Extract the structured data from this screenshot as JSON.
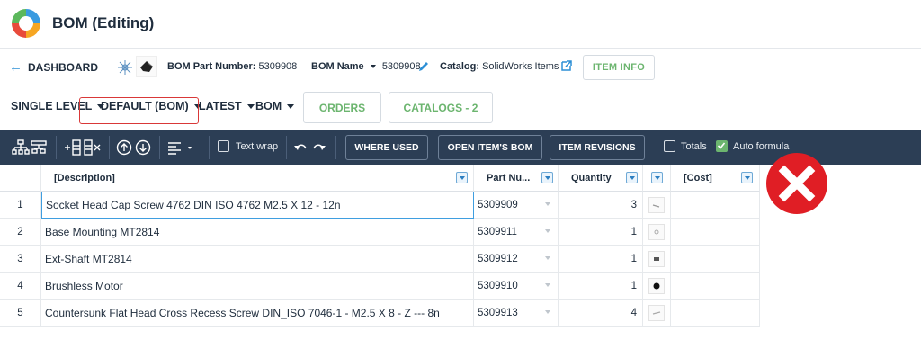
{
  "app": {
    "title": "BOM (Editing)"
  },
  "nav": {
    "back_label": "DASHBOARD",
    "part_number_label": "BOM Part Number:",
    "part_number_value": "5309908",
    "bom_name_label": "BOM Name",
    "bom_name_value": "5309908",
    "catalog_label": "Catalog:",
    "catalog_value": "SolidWorks Items",
    "item_info_label": "ITEM INFO"
  },
  "selectors": {
    "level": "SINGLE LEVEL",
    "view": "DEFAULT (BOM)",
    "revision": "LATEST",
    "type": "BOM",
    "orders_label": "ORDERS",
    "catalogs_label": "CATALOGS - 2"
  },
  "toolbar": {
    "text_wrap_label": "Text wrap",
    "text_wrap_checked": false,
    "where_used_label": "WHERE USED",
    "open_bom_label": "OPEN ITEM'S BOM",
    "item_revisions_label": "ITEM REVISIONS",
    "totals_label": "Totals",
    "totals_checked": false,
    "auto_formula_label": "Auto formula",
    "auto_formula_checked": true
  },
  "table": {
    "columns": {
      "description": "[Description]",
      "part_number": "Part Nu...",
      "quantity": "Quantity",
      "image": "",
      "cost": "[Cost]"
    },
    "rows": [
      {
        "num": "1",
        "description": "Socket Head Cap Screw 4762 DIN ISO 4762 M2.5 X 12 - 12n",
        "part_number": "5309909",
        "quantity": "3",
        "cost": ""
      },
      {
        "num": "2",
        "description": "Base Mounting MT2814",
        "part_number": "5309911",
        "quantity": "1",
        "cost": ""
      },
      {
        "num": "3",
        "description": "Ext-Shaft MT2814",
        "part_number": "5309912",
        "quantity": "1",
        "cost": ""
      },
      {
        "num": "4",
        "description": "Brushless Motor",
        "part_number": "5309910",
        "quantity": "1",
        "cost": ""
      },
      {
        "num": "5",
        "description": "Countersunk Flat Head Cross Recess Screw DIN_ISO 7046-1 - M2.5 X 8 - Z --- 8n",
        "part_number": "5309913",
        "quantity": "4",
        "cost": ""
      }
    ]
  },
  "colors": {
    "accent_blue": "#2d8fd5",
    "toolbar_bg": "#2c3e55",
    "green": "#6cb56f",
    "highlight_red": "#d93838",
    "error_red": "#e01e25"
  }
}
